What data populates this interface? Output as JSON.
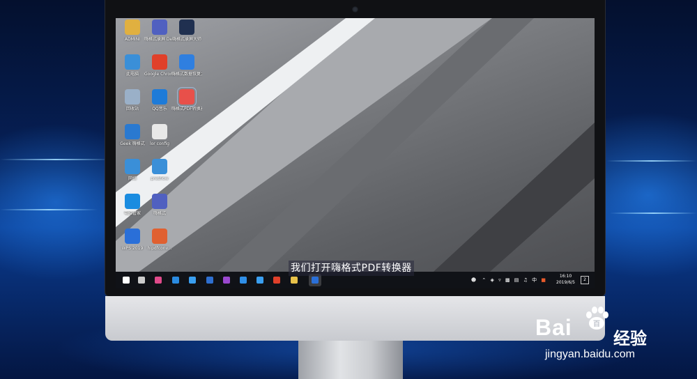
{
  "subtitle": "我们打开嗨格式PDF转换器",
  "desktop_icons": [
    {
      "label": "ADMINI",
      "color": "#e0b040",
      "icon": "user-folder-icon"
    },
    {
      "label": "嗨格式录屏 Desktop 1",
      "color": "#5060c0",
      "icon": "app-icon"
    },
    {
      "label": "嗨格式录屏大师",
      "color": "#203050",
      "icon": "screen-recorder-icon"
    },
    {
      "label": "此电脑",
      "color": "#3a8fd8",
      "icon": "computer-icon"
    },
    {
      "label": "Google Chrome",
      "color": "#e0402a",
      "icon": "chrome-icon"
    },
    {
      "label": "嗨格式数据恢复大师",
      "color": "#2f7fe0",
      "icon": "data-recovery-icon"
    },
    {
      "label": "回收站",
      "color": "#9ab0c8",
      "icon": "recycle-bin-icon"
    },
    {
      "label": "QQ音乐",
      "color": "#1e7bd8",
      "icon": "qq-music-icon"
    },
    {
      "label": "嗨格式PDF转换器",
      "color": "#e8504a",
      "icon": "pdf-converter-icon"
    },
    {
      "label": "Geek 嗨格式",
      "color": "#2a79d0",
      "icon": "app-icon"
    },
    {
      "label": "lor config",
      "color": "#e8e8e8",
      "icon": "file-icon"
    },
    {
      "label": "网络",
      "color": "#3a8fd8",
      "icon": "network-icon"
    },
    {
      "label": "presflow",
      "color": "#3a8fd8",
      "icon": "laptop-icon"
    },
    {
      "label": "电脑管家",
      "color": "#1a8ce0",
      "icon": "pc-manager-icon"
    },
    {
      "label": "嗨格式",
      "color": "#5060c0",
      "icon": "app-icon"
    },
    {
      "label": "WPS 2019",
      "color": "#2a6fd8",
      "icon": "wps-icon"
    },
    {
      "label": "hipdfconv...",
      "color": "#e06030",
      "icon": "installer-icon"
    }
  ],
  "taskbar": {
    "apps": [
      {
        "name": "start-icon",
        "color": "#ffffff"
      },
      {
        "name": "task-view-icon",
        "color": "#cccccc"
      },
      {
        "name": "photos-app-icon",
        "color": "#e04a8a"
      },
      {
        "name": "browser-app-icon",
        "color": "#2a8be0"
      },
      {
        "name": "media-app-icon",
        "color": "#3a9ff0"
      },
      {
        "name": "photoshop-icon",
        "color": "#2e6fd0"
      },
      {
        "name": "premiere-icon",
        "color": "#9a48d0"
      },
      {
        "name": "edge-icon",
        "color": "#2f8fe8"
      },
      {
        "name": "app-icon",
        "color": "#3a9ff0"
      },
      {
        "name": "chrome-icon",
        "color": "#e0402a"
      },
      {
        "name": "file-explorer-icon",
        "color": "#e8c24a"
      },
      {
        "name": "wps-icon",
        "color": "#2a6fd8"
      }
    ],
    "tray_text": "中",
    "time": "16:10",
    "date": "2019/6/5",
    "notification_count": "2"
  },
  "watermark": {
    "brand": "Bai",
    "brand_tail": "百",
    "cn_text": "经验",
    "url": "jingyan.baidu.com"
  }
}
